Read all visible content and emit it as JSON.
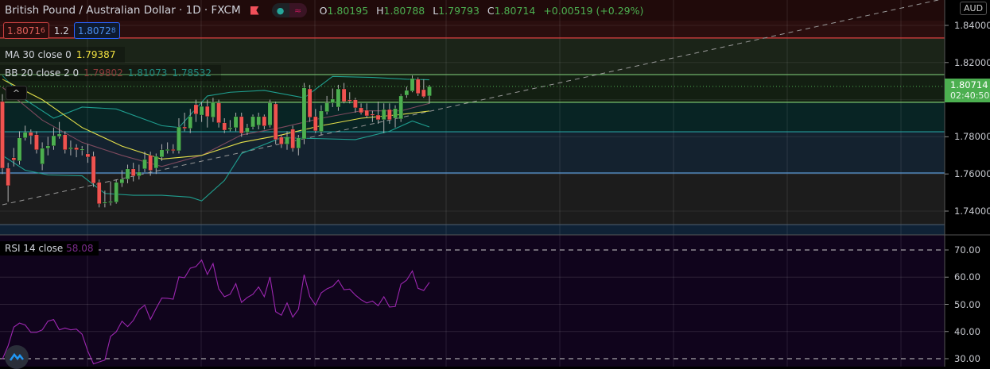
{
  "header": {
    "title": "British Pound / Australian Dollar · 1D · FXCM",
    "ohlc": [
      {
        "k": "O",
        "v": "1.80195"
      },
      {
        "k": "H",
        "v": "1.80788"
      },
      {
        "k": "L",
        "v": "1.79793"
      },
      {
        "k": "C",
        "v": "1.80714"
      }
    ],
    "change": "+0.00519 (+0.29%)",
    "pill_a": "●",
    "pill_b": "≈"
  },
  "trade": {
    "sell_main": "1.8071",
    "sell_sup": "6",
    "spread": "1.2",
    "buy_main": "1.8072",
    "buy_sup": "8"
  },
  "legend": {
    "ma_label": "MA 30 close 0",
    "ma_value": "1.79387",
    "bb_label": "BB 20 close 2 0",
    "bb_basis": "1.79802",
    "bb_upper": "1.81073",
    "bb_lower": "1.78532",
    "collapse": "^"
  },
  "rsi": {
    "label": "RSI 14 close",
    "value": "58.08"
  },
  "axis": {
    "currency": "AUD",
    "price_labels": [
      "1.84000",
      "1.82000",
      "1.78000",
      "1.76000",
      "1.74000"
    ],
    "rsi_labels": [
      "70.00",
      "60.00",
      "50.00",
      "40.00",
      "30.00"
    ],
    "last_price": "1.80714",
    "countdown": "02:40:50"
  },
  "colors": {
    "up": "#4caf50",
    "down": "#ef5350",
    "ma": "#e5e04a",
    "bb_basis": "#7e4a5e",
    "bb_band": "#1f9e8f",
    "rsi": "#9c27b0"
  },
  "chart_data": {
    "type": "candlestick",
    "ylim": [
      1.727,
      1.853
    ],
    "candles": [
      [
        1.799,
        1.803,
        1.76,
        1.7631
      ],
      [
        1.7631,
        1.766,
        1.745,
        1.7537
      ],
      [
        1.7687,
        1.774,
        1.764,
        1.7674
      ],
      [
        1.767,
        1.783,
        1.765,
        1.7794
      ],
      [
        1.7794,
        1.786,
        1.778,
        1.7824
      ],
      [
        1.7824,
        1.784,
        1.776,
        1.7806
      ],
      [
        1.7811,
        1.783,
        1.771,
        1.773
      ],
      [
        1.7653,
        1.777,
        1.762,
        1.7738
      ],
      [
        1.7738,
        1.78,
        1.77,
        1.7751
      ],
      [
        1.7751,
        1.785,
        1.773,
        1.7806
      ],
      [
        1.7802,
        1.788,
        1.779,
        1.7815
      ],
      [
        1.7811,
        1.783,
        1.771,
        1.773
      ],
      [
        1.7734,
        1.778,
        1.77,
        1.7742
      ],
      [
        1.7742,
        1.776,
        1.769,
        1.773
      ],
      [
        1.773,
        1.775,
        1.77,
        1.7734
      ],
      [
        1.7708,
        1.776,
        1.766,
        1.7691
      ],
      [
        1.7695,
        1.772,
        1.753,
        1.755
      ],
      [
        1.7555,
        1.757,
        1.742,
        1.7439
      ],
      [
        1.7444,
        1.751,
        1.742,
        1.7448
      ],
      [
        1.7448,
        1.756,
        1.743,
        1.7452
      ],
      [
        1.7448,
        1.757,
        1.744,
        1.7555
      ],
      [
        1.755,
        1.762,
        1.753,
        1.7572
      ],
      [
        1.7572,
        1.765,
        1.755,
        1.7627
      ],
      [
        1.7627,
        1.766,
        1.756,
        1.7589
      ],
      [
        1.7589,
        1.765,
        1.757,
        1.761
      ],
      [
        1.7627,
        1.772,
        1.761,
        1.7678
      ],
      [
        1.77,
        1.772,
        1.759,
        1.7619
      ],
      [
        1.7631,
        1.771,
        1.76,
        1.7695
      ],
      [
        1.7691,
        1.776,
        1.767,
        1.773
      ],
      [
        1.773,
        1.777,
        1.771,
        1.7732
      ],
      [
        1.7732,
        1.776,
        1.771,
        1.773
      ],
      [
        1.7725,
        1.79,
        1.771,
        1.7853
      ],
      [
        1.7853,
        1.793,
        1.783,
        1.7845
      ],
      [
        1.7845,
        1.795,
        1.782,
        1.7909
      ],
      [
        1.7973,
        1.8,
        1.788,
        1.7922
      ],
      [
        1.7917,
        1.799,
        1.788,
        1.7964
      ],
      [
        1.7964,
        1.8,
        1.785,
        1.7909
      ],
      [
        1.7905,
        1.801,
        1.788,
        1.7986
      ],
      [
        1.7982,
        1.8,
        1.785,
        1.7875
      ],
      [
        1.7875,
        1.79,
        1.782,
        1.7836
      ],
      [
        1.7841,
        1.789,
        1.783,
        1.7849
      ],
      [
        1.7849,
        1.793,
        1.783,
        1.7909
      ],
      [
        1.7909,
        1.793,
        1.78,
        1.7819
      ],
      [
        1.7824,
        1.787,
        1.781,
        1.7849
      ],
      [
        1.7853,
        1.792,
        1.784,
        1.7909
      ],
      [
        1.7862,
        1.793,
        1.784,
        1.7909
      ],
      [
        1.7909,
        1.792,
        1.784,
        1.7858
      ],
      [
        1.7862,
        1.8,
        1.785,
        1.7982
      ],
      [
        1.7977,
        1.799,
        1.776,
        1.7785
      ],
      [
        1.7798,
        1.781,
        1.774,
        1.776
      ],
      [
        1.776,
        1.783,
        1.773,
        1.78
      ],
      [
        1.7841,
        1.786,
        1.772,
        1.7738
      ],
      [
        1.7738,
        1.781,
        1.77,
        1.7794
      ],
      [
        1.7789,
        1.809,
        1.776,
        1.8063
      ],
      [
        1.8058,
        1.808,
        1.788,
        1.7905
      ],
      [
        1.7909,
        1.795,
        1.782,
        1.7832
      ],
      [
        1.7828,
        1.797,
        1.781,
        1.7939
      ],
      [
        1.7935,
        1.802,
        1.792,
        1.7982
      ],
      [
        1.7982,
        1.806,
        1.796,
        1.8003
      ],
      [
        1.796,
        1.808,
        1.794,
        1.8058
      ],
      [
        1.8058,
        1.809,
        1.798,
        1.799
      ],
      [
        1.7999,
        1.804,
        1.798,
        1.7995
      ],
      [
        1.7999,
        1.801,
        1.793,
        1.7956
      ],
      [
        1.7956,
        1.798,
        1.792,
        1.793
      ],
      [
        1.7943,
        1.798,
        1.79,
        1.7913
      ],
      [
        1.7922,
        1.794,
        1.788,
        1.792
      ],
      [
        1.7917,
        1.799,
        1.787,
        1.7892
      ],
      [
        1.7892,
        1.798,
        1.782,
        1.7947
      ],
      [
        1.7947,
        1.798,
        1.787,
        1.7892
      ],
      [
        1.79,
        1.797,
        1.785,
        1.7952
      ],
      [
        1.7896,
        1.803,
        1.788,
        1.802
      ],
      [
        1.8024,
        1.807,
        1.801,
        1.805
      ],
      [
        1.8046,
        1.813,
        1.804,
        1.8114
      ],
      [
        1.811,
        1.812,
        1.802,
        1.8033
      ],
      [
        1.8054,
        1.811,
        1.801,
        1.8016
      ],
      [
        1.802,
        1.8079,
        1.7979,
        1.8071
      ]
    ],
    "ma30": [
      [
        0,
        1.811
      ],
      [
        7,
        1.8
      ],
      [
        14,
        1.785
      ],
      [
        21,
        1.775
      ],
      [
        28,
        1.768
      ],
      [
        35,
        1.77
      ],
      [
        42,
        1.777
      ],
      [
        49,
        1.781
      ],
      [
        56,
        1.786
      ],
      [
        63,
        1.79
      ],
      [
        70,
        1.792
      ],
      [
        75,
        1.7939
      ]
    ],
    "bb_basis": [
      [
        0,
        1.8067
      ],
      [
        7,
        1.789
      ],
      [
        14,
        1.777
      ],
      [
        21,
        1.77
      ],
      [
        28,
        1.764
      ],
      [
        35,
        1.77
      ],
      [
        42,
        1.781
      ],
      [
        49,
        1.785
      ],
      [
        56,
        1.79
      ],
      [
        63,
        1.794
      ],
      [
        70,
        1.794
      ],
      [
        75,
        1.798
      ]
    ],
    "bb_upper": [
      [
        0,
        1.813
      ],
      [
        4,
        1.8
      ],
      [
        9,
        1.79
      ],
      [
        14,
        1.796
      ],
      [
        20,
        1.795
      ],
      [
        28,
        1.786
      ],
      [
        31,
        1.785
      ],
      [
        36,
        1.802
      ],
      [
        40,
        1.804
      ],
      [
        46,
        1.805
      ],
      [
        53,
        1.801
      ],
      [
        58,
        1.8125
      ],
      [
        65,
        1.812
      ],
      [
        71,
        1.811
      ],
      [
        75,
        1.8107
      ]
    ],
    "bb_lower": [
      [
        0,
        1.77
      ],
      [
        4,
        1.762
      ],
      [
        8,
        1.7595
      ],
      [
        14,
        1.759
      ],
      [
        18,
        1.7495
      ],
      [
        23,
        1.7485
      ],
      [
        28,
        1.7485
      ],
      [
        33,
        1.7475
      ],
      [
        35,
        1.7455
      ],
      [
        39,
        1.7565
      ],
      [
        42,
        1.771
      ],
      [
        49,
        1.7795
      ],
      [
        56,
        1.779
      ],
      [
        62,
        1.7785
      ],
      [
        68,
        1.783
      ],
      [
        72,
        1.7885
      ],
      [
        75,
        1.7853
      ]
    ],
    "trendline": [
      [
        0,
        1.7434
      ],
      [
        164.4,
        1.8537
      ]
    ],
    "levels": [
      {
        "price": 1.8332,
        "color": "#e04040"
      },
      {
        "price": 1.8135,
        "color": "#6fb06a"
      },
      {
        "price": 1.7986,
        "color": "#7cc86e"
      },
      {
        "price": 1.7827,
        "color": "#26a0a0"
      },
      {
        "price": 1.7605,
        "color": "#5a9ad8"
      },
      {
        "price": 1.7327,
        "color": "#4a5a6a"
      }
    ],
    "rsi_values": [
      29.8,
      34.7,
      41.6,
      43.1,
      42.4,
      39.7,
      39.7,
      40.6,
      43.8,
      44.4,
      40.6,
      41.3,
      40.6,
      40.9,
      39.0,
      32.8,
      28.1,
      28.8,
      29.5,
      38.2,
      39.9,
      43.8,
      41.8,
      44.1,
      48.0,
      49.7,
      44.4,
      48.5,
      52.3,
      52.2,
      51.9,
      60.1,
      59.8,
      63.3,
      63.9,
      66.3,
      61.0,
      65.0,
      55.7,
      52.8,
      53.7,
      57.6,
      50.7,
      52.5,
      53.7,
      56.4,
      52.8,
      60.1,
      47.3,
      46.0,
      50.5,
      45.3,
      48.2,
      60.9,
      52.8,
      49.7,
      54.2,
      55.7,
      56.6,
      58.9,
      55.4,
      55.6,
      53.4,
      51.7,
      50.5,
      51.2,
      49.5,
      52.8,
      49.0,
      49.2,
      57.4,
      58.9,
      62.3,
      55.9,
      55.1,
      58.1
    ],
    "rsi_ylim": [
      30,
      70
    ]
  }
}
